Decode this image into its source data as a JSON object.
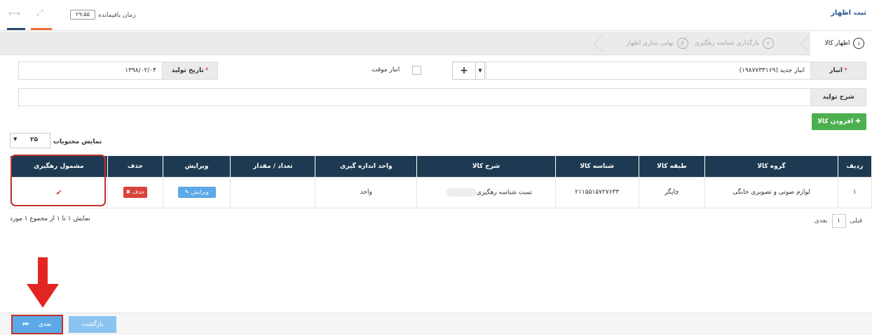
{
  "header": {
    "title": "ثبت اظهار",
    "timer_label": "زمان باقیمانده",
    "timer_value": "۲۹:۵۵"
  },
  "wizard": {
    "steps": [
      {
        "num": "۱",
        "label": "اظهار کالا"
      },
      {
        "num": "۲",
        "label": "بارگذاری شناسه رهگیری"
      },
      {
        "num": "۳",
        "label": "نهایی سازی اظهار"
      }
    ]
  },
  "form": {
    "warehouse_label": "انبار",
    "warehouse_value": "انبار جدید (۱۹۸۷۷۳۳۱۶۹)",
    "temp_warehouse_label": "انبار موقت",
    "prod_date_label": "تاریخ تولید",
    "prod_date_value": "۱۳۹۸/۰۲/۰۴",
    "prod_desc_label": "شرح تولید",
    "prod_desc_value": "",
    "add_goods_label": "افزودن کالا"
  },
  "table": {
    "show_label": "نمایش محتویات",
    "page_length": "۲۵",
    "columns": [
      "ردیف",
      "گروه کالا",
      "طبقه کالا",
      "شناسه کالا",
      "شرح کالا",
      "واحد اندازه گیری",
      "تعداد / مقدار",
      "ویرایش",
      "حذف",
      "مشمول رهگیری"
    ],
    "rows": [
      {
        "row": "۱",
        "group": "لوازم صوتی و تصویری خانگی",
        "category": "چاپگر",
        "id": "۲۱۱۵۵۱۵۷۲۷۶۳۳",
        "desc": "تست شناسه رهگیری",
        "unit": "واحد",
        "qty": "",
        "edit": "ویرایش",
        "delete": "حذف"
      }
    ],
    "summary": "نمایش ۱ تا ۱ از مجموع ۱ مورد",
    "pager": {
      "prev": "قبلی",
      "page": "۱",
      "next": "بعدی"
    }
  },
  "actions": {
    "next_label": "بعدی",
    "back_label": "بازگشت"
  },
  "colors": {
    "header_bg": "#1e3a52",
    "accent_blue": "#5da8e6",
    "danger": "#d9433b",
    "success": "#4caf50"
  }
}
